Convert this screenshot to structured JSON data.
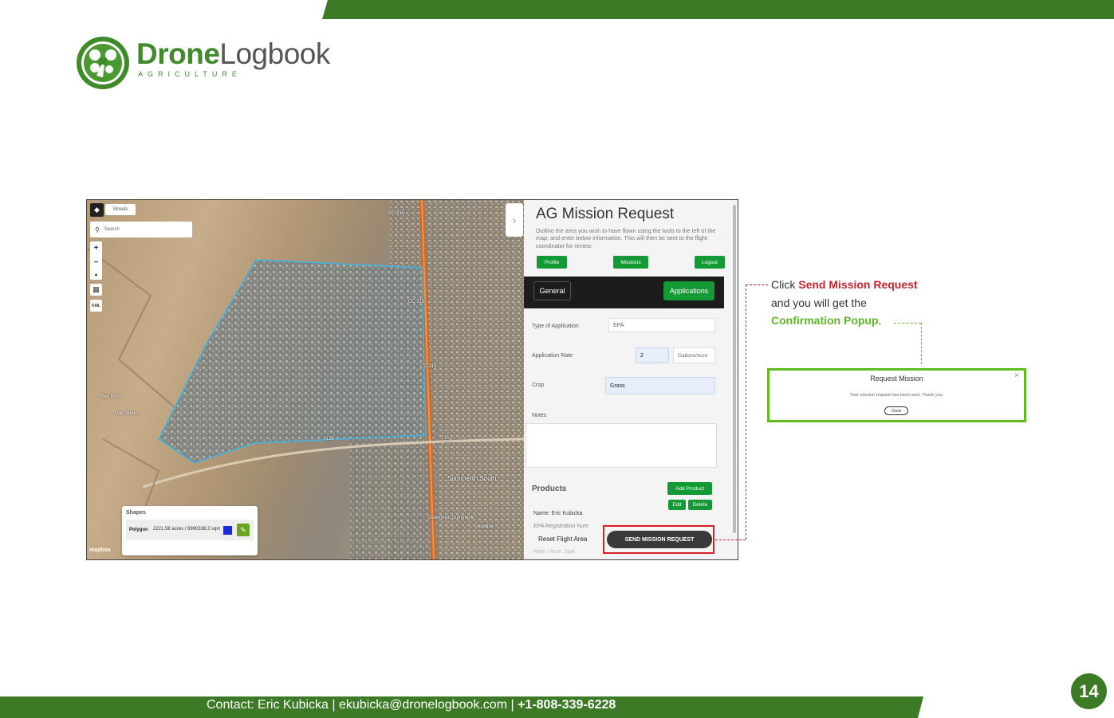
{
  "brand": {
    "name_bold": "Drone",
    "name_light": "Logbook",
    "subtitle": "AGRICULTURE",
    "accent_color": "#3d7a26",
    "logo_icon": "drone-logo-icon"
  },
  "map": {
    "layer_button": "Streets",
    "search_placeholder": "Search",
    "zoom_in": "+",
    "zoom_out": "−",
    "compass": "▲",
    "trash_icon": "🗑",
    "kml_label": "KML",
    "attribution": "mapbox",
    "labels": {
      "road1": "CC 215",
      "road2": "CC 215",
      "road3": "CC 215",
      "hwy159": "159",
      "hwy160": "159",
      "place1": "Red Rock",
      "place2": "Gap Sump",
      "place3": "Summerlin South",
      "place4": "Downtown Summerlin",
      "place5": "Paradise"
    },
    "shapes": {
      "title": "Shapes",
      "type": "Polygon",
      "area": "2221.58 acres / 8990336.3 sqm",
      "color": "#1f2bd9"
    }
  },
  "panel": {
    "title": "AG Mission Request",
    "description": "Outline the area you wish to have flown using the tools to the left of the map; and enter below information. This will then be sent to the flight coordinator for review.",
    "buttons": {
      "profile": "Profile",
      "missions": "Missions",
      "logout": "Logout"
    },
    "tabs": {
      "general": "General",
      "applications": "Applications"
    },
    "form": {
      "type_label": "Type of Application",
      "type_value": "EPA",
      "rate_label": "Application Rate",
      "rate_value": "2",
      "rate_unit": "Gallons/Acre",
      "crop_label": "Crop",
      "crop_value": "Grass",
      "notes_label": "Notes"
    },
    "products": {
      "title": "Products",
      "add": "Add Product",
      "edit": "Edit",
      "delete": "Delete",
      "name_line": "Name: Eric Kubicka",
      "epa_line": "EPA Registration Num",
      "rate_line": "Rate / Acre: 2gal"
    },
    "reset": "Reset Flight Area",
    "send": "SEND MISSION REQUEST"
  },
  "callout": {
    "prefix": "Click ",
    "action": "Send Mission Request",
    "middle": "and you will get the",
    "result": "Confirmation Popup",
    "suffix": "."
  },
  "popup": {
    "title": "Request Mission",
    "message": "Your mission request has been sent. Thank you.",
    "close_button": "Close",
    "close_icon": "×"
  },
  "footer": {
    "text": "Contact: Eric Kubicka  |  ekubicka@dronelogbook.com  |  ",
    "phone": "+1-808-339-6228",
    "page": "14"
  }
}
